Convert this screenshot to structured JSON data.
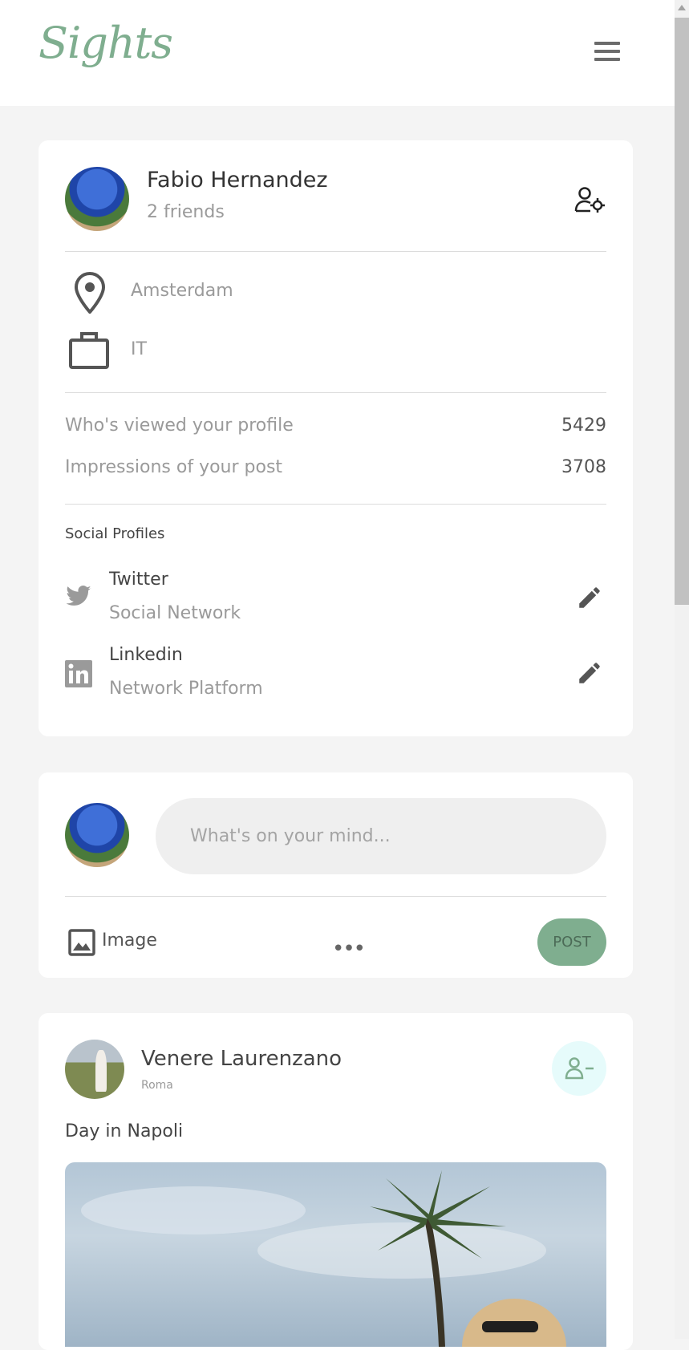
{
  "app": {
    "logo": "Sights"
  },
  "profile": {
    "name": "Fabio Hernandez",
    "friends": "2 friends",
    "location": "Amsterdam",
    "work": "IT",
    "stats": [
      {
        "label": "Who's viewed your profile",
        "value": "5429"
      },
      {
        "label": "Impressions of your post",
        "value": "3708"
      }
    ],
    "social_title": "Social Profiles",
    "social": [
      {
        "name": "Twitter",
        "type": "Social Network",
        "icon": "twitter-icon"
      },
      {
        "name": "Linkedin",
        "type": "Network Platform",
        "icon": "linkedin-icon"
      }
    ]
  },
  "composer": {
    "placeholder": "What's on your mind...",
    "image_label": "Image",
    "post_label": "POST"
  },
  "post": {
    "author": "Venere Laurenzano",
    "location": "Roma",
    "text": "Day in Napoli"
  },
  "colors": {
    "accent": "#7fae8f",
    "background": "#f4f4f4",
    "unfriend_bg": "#e6fbfb"
  }
}
